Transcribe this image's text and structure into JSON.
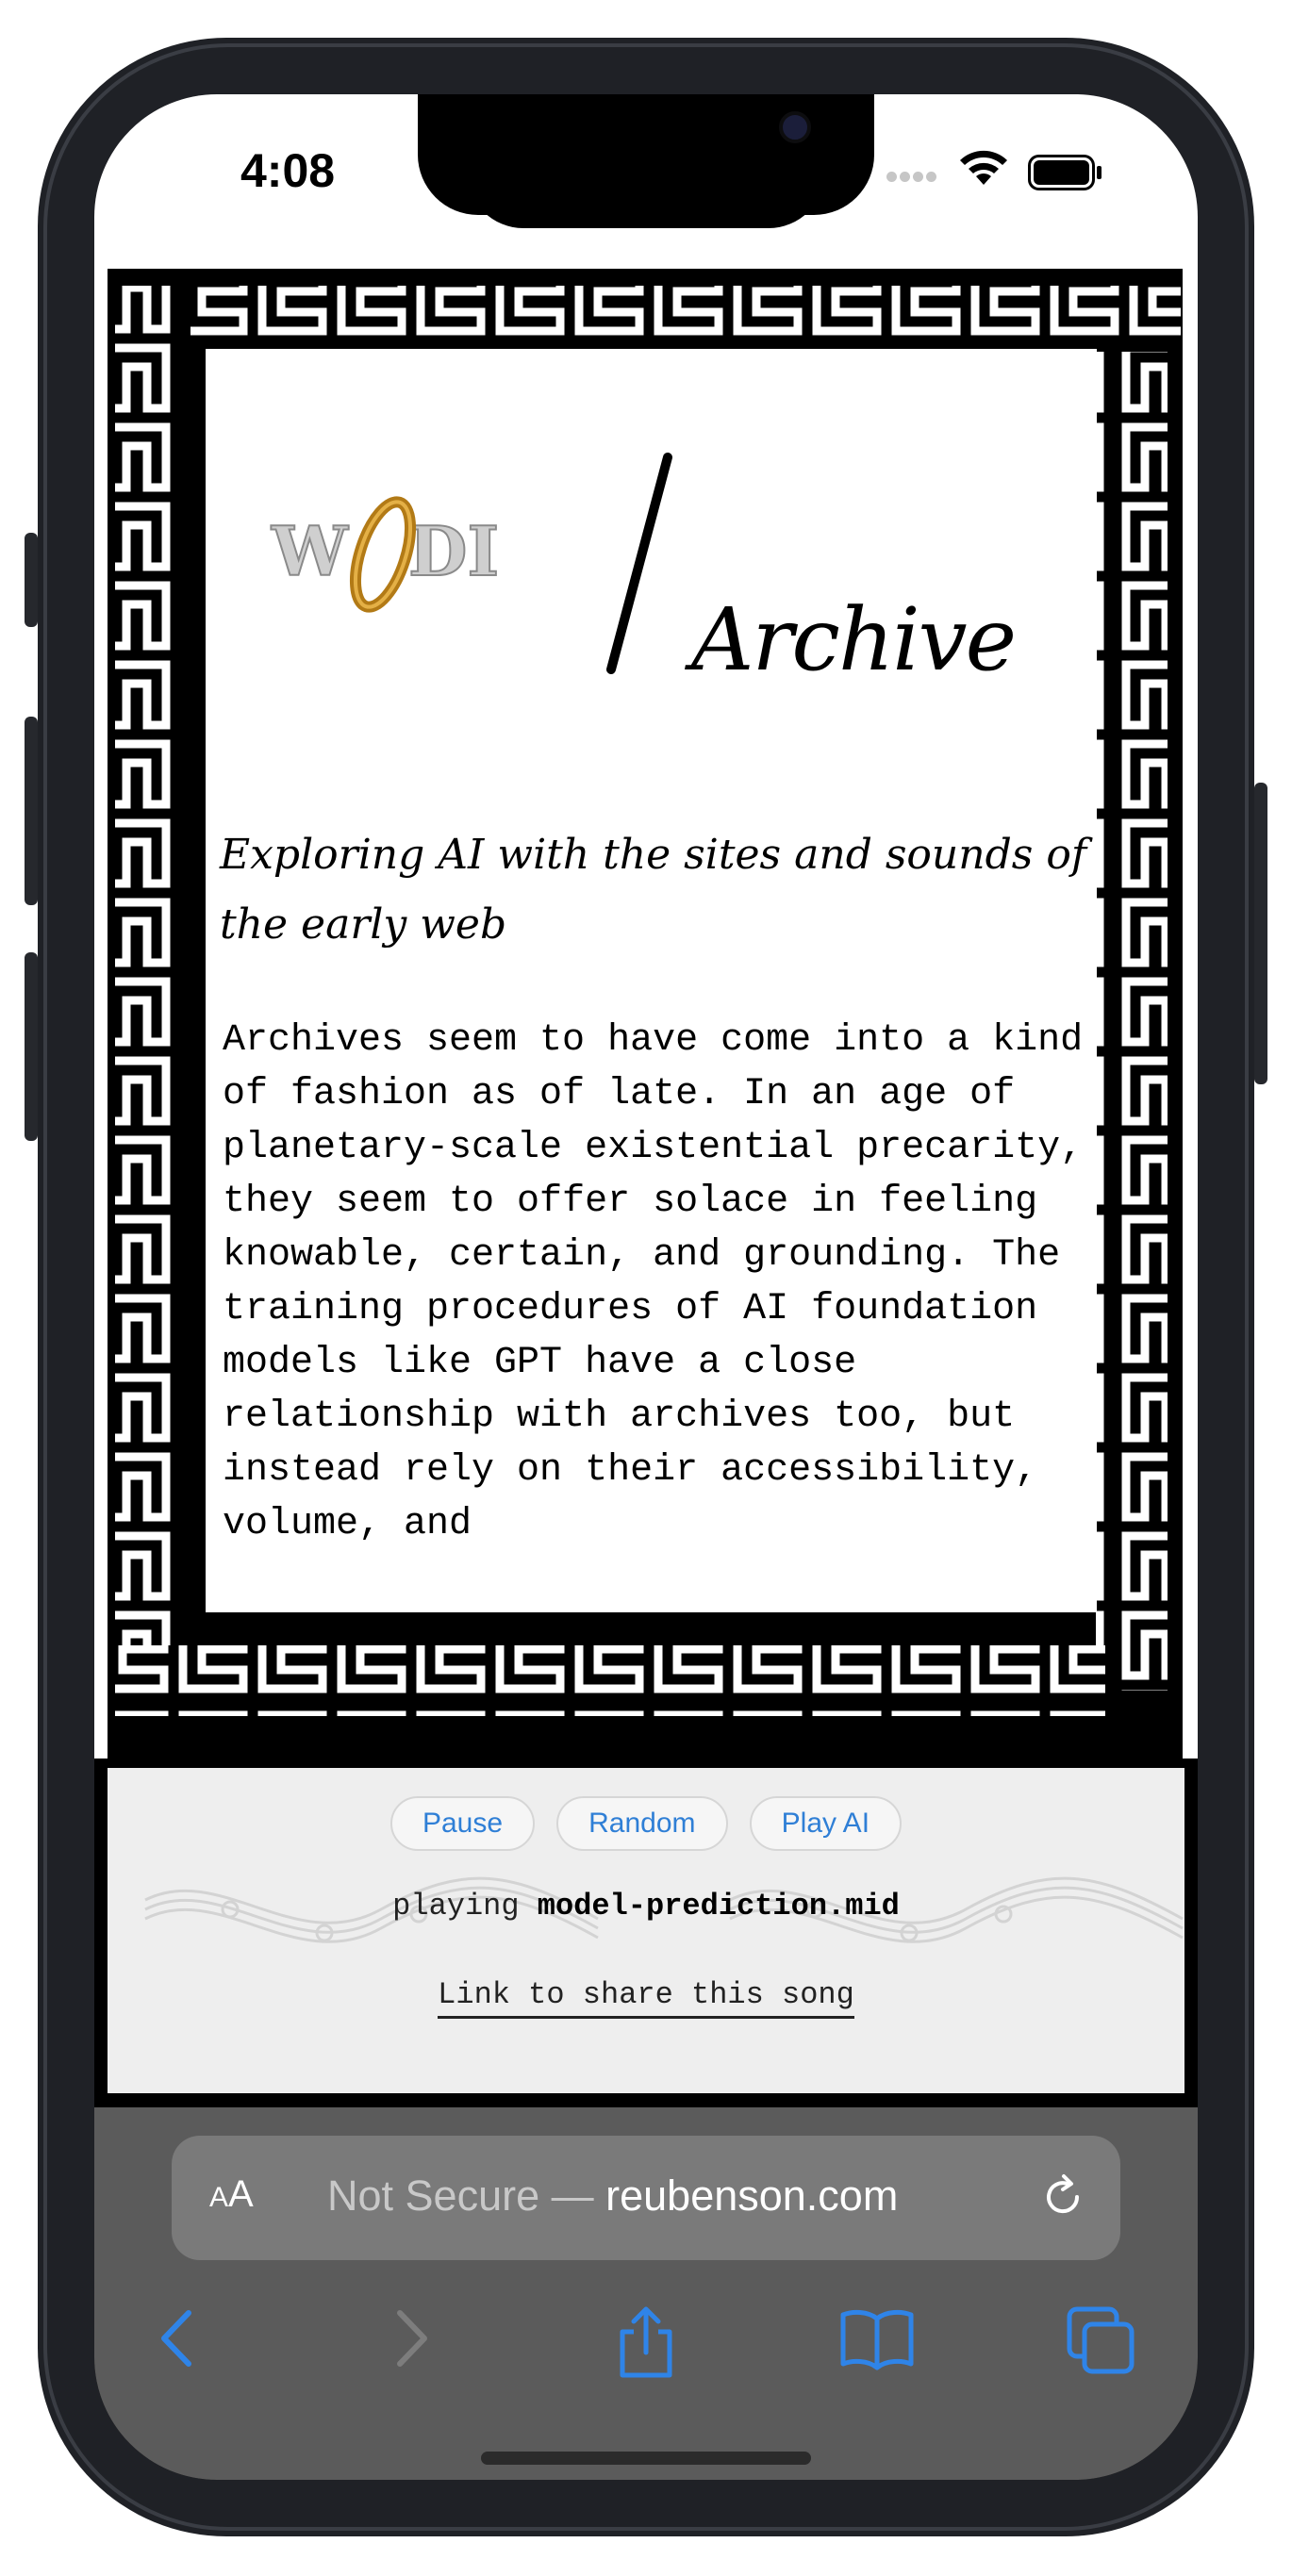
{
  "status": {
    "time": "4:08"
  },
  "page": {
    "logo_text": "WIDI",
    "title": "Archive",
    "subtitle": "Exploring AI with the sites and sounds of the early web",
    "body": "Archives seem to have come into a kind of fashion as of late. In an age of planetary-scale existential precarity, they seem to offer solace in feeling knowable, certain, and grounding. The training procedures of AI foundation models like GPT have a close relationship with archives too, but instead rely on their accessibility, volume, and"
  },
  "player": {
    "buttons": [
      "Pause",
      "Random",
      "Play AI"
    ],
    "playing_prefix": "playing",
    "playing_file": "model-prediction.mid",
    "share_link": "Link to share this song"
  },
  "safari": {
    "aa_small": "A",
    "aa_large": "A",
    "url_prefix": "Not Secure — ",
    "url_domain": "reubenson.com"
  },
  "icons": [
    "back-icon",
    "forward-icon",
    "share-icon",
    "bookmarks-icon",
    "tabs-icon",
    "reload-icon",
    "wifi-icon",
    "battery-icon"
  ]
}
